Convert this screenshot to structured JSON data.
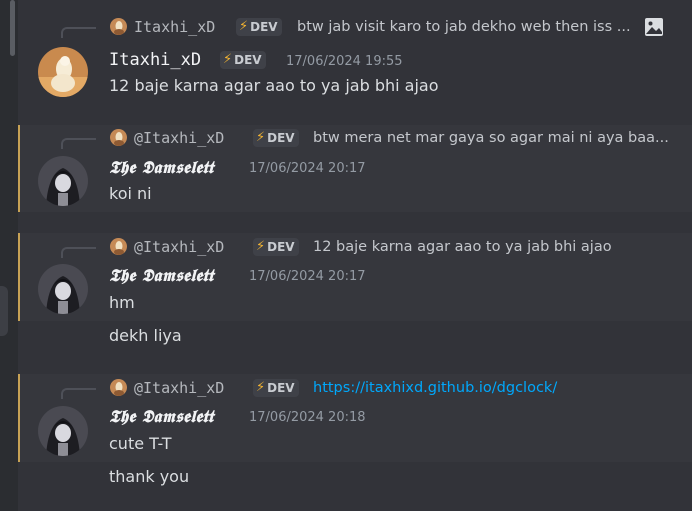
{
  "colors": {
    "background": "#323339",
    "highlight": "#36373d",
    "mention_bar": "#c7a255",
    "link": "#00a8fc",
    "bolt": "#f0b232",
    "timestamp": "#949ba4"
  },
  "messages": [
    {
      "reply": {
        "author": "Itaxhi_xD",
        "tag": "DEV",
        "text": "btw jab visit karo to jab dekho web then  iss ...",
        "has_image_icon": true,
        "icon": "image-icon"
      },
      "author": "Itaxhi_xD",
      "tag": "DEV",
      "time": "17/06/2024 19:55",
      "lines": [
        "12 baje karna agar aao to ya jab bhi ajao"
      ]
    },
    {
      "reply": {
        "author": "@Itaxhi_xD",
        "tag": "DEV",
        "text": "btw mera net mar gaya so agar mai ni aya baa..."
      },
      "author": "𝕿𝖍𝖊 𝕯𝖆𝖒𝖘𝖊𝖑𝖊𝖙𝖙",
      "time": "17/06/2024 20:17",
      "lines": [
        "koi ni"
      ]
    },
    {
      "reply": {
        "author": "@Itaxhi_xD",
        "tag": "DEV",
        "text": "12 baje karna agar aao to ya jab bhi ajao"
      },
      "author": "𝕿𝖍𝖊 𝕯𝖆𝖒𝖘𝖊𝖑𝖊𝖙𝖙",
      "time": "17/06/2024 20:17",
      "lines": [
        "hm",
        "dekh liya"
      ]
    },
    {
      "reply": {
        "author": "@Itaxhi_xD",
        "tag": "DEV",
        "text": "https://itaxhixd.github.io/dgclock/"
      },
      "author": "𝕿𝖍𝖊 𝕯𝖆𝖒𝖘𝖊𝖑𝖊𝖙𝖙",
      "time": "17/06/2024 20:18",
      "lines": [
        "cute T-T",
        "thank you"
      ]
    }
  ]
}
